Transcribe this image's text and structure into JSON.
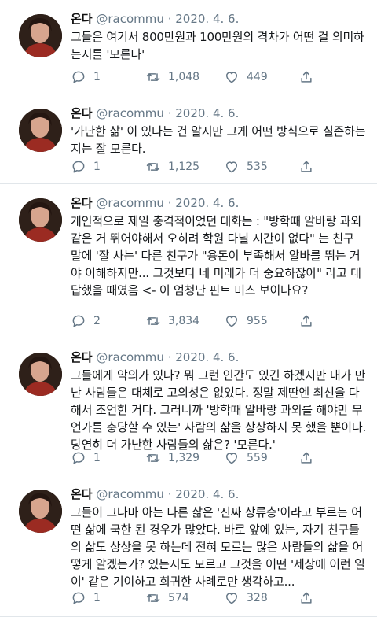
{
  "tweets": [
    {
      "name": "온다",
      "handle": "@racommu",
      "sep": "·",
      "date": "2020. 4. 6.",
      "text": "그들은 여기서 800만원과 100만원의 격차가 어떤 걸 의미하는지를 '모른다'",
      "replies": "1",
      "retweets": "1,048",
      "likes": "449"
    },
    {
      "name": "온다",
      "handle": "@racommu",
      "sep": "·",
      "date": "2020. 4. 6.",
      "text": "'가난한 삶' 이 있다는 건 알지만 그게 어떤 방식으로 실존하는지는 잘 모른다.",
      "replies": "1",
      "retweets": "1,125",
      "likes": "535"
    },
    {
      "name": "온다",
      "handle": "@racommu",
      "sep": "·",
      "date": "2020. 4. 6.",
      "text": "개인적으로 제일 충격적이었던 대화는 : \"방학때 알바랑 과외 같은 거 뛰어야해서 오히려 학원 다닐 시간이 없다\" 는 친구 말에 '잘 사는' 다른 친구가 \"용돈이 부족해서 알바를 뛰는 거야 이해하지만... 그것보다 네 미래가 더 중요하잖아\" 라고 대답했을 때였음 <- 이 엄청난 핀트 미스 보이나요?",
      "replies": "2",
      "retweets": "3,834",
      "likes": "955"
    },
    {
      "name": "온다",
      "handle": "@racommu",
      "sep": "·",
      "date": "2020. 4. 6.",
      "text": "그들에게 악의가 있나? 뭐 그런 인간도 있긴 하겠지만 내가 만난 사람들은 대체로 고의성은 없었다. 정말 제딴엔 최선을 다해서 조언한 거다. 그러니까 '방학때 알바랑 과외를 해야만 무언가를 충당할 수 있는' 사람의 삶을 상상하지 못 했을 뿐이다. 당연히 더 가난한 사람들의 삶은? '모른다.'",
      "replies": "1",
      "retweets": "1,329",
      "likes": "559"
    },
    {
      "name": "온다",
      "handle": "@racommu",
      "sep": "·",
      "date": "2020. 4. 6.",
      "text": "그들이 그나마 아는 다른 삶은 '진짜 상류층'이라고 부르는 어떤 삶에 국한 된 경우가 많았다. 바로 앞에 있는, 자기 친구들의 삶도 상상을 못 하는데 전혀 모르는 많은 사람들의 삶을 어떻게 알겠는가? 있는지도 모르고 그것을 어떤 '세상에 이런 일이' 같은 기이하고 희귀한 사례로만 생각하고...",
      "replies": "1",
      "retweets": "574",
      "likes": "328"
    }
  ]
}
